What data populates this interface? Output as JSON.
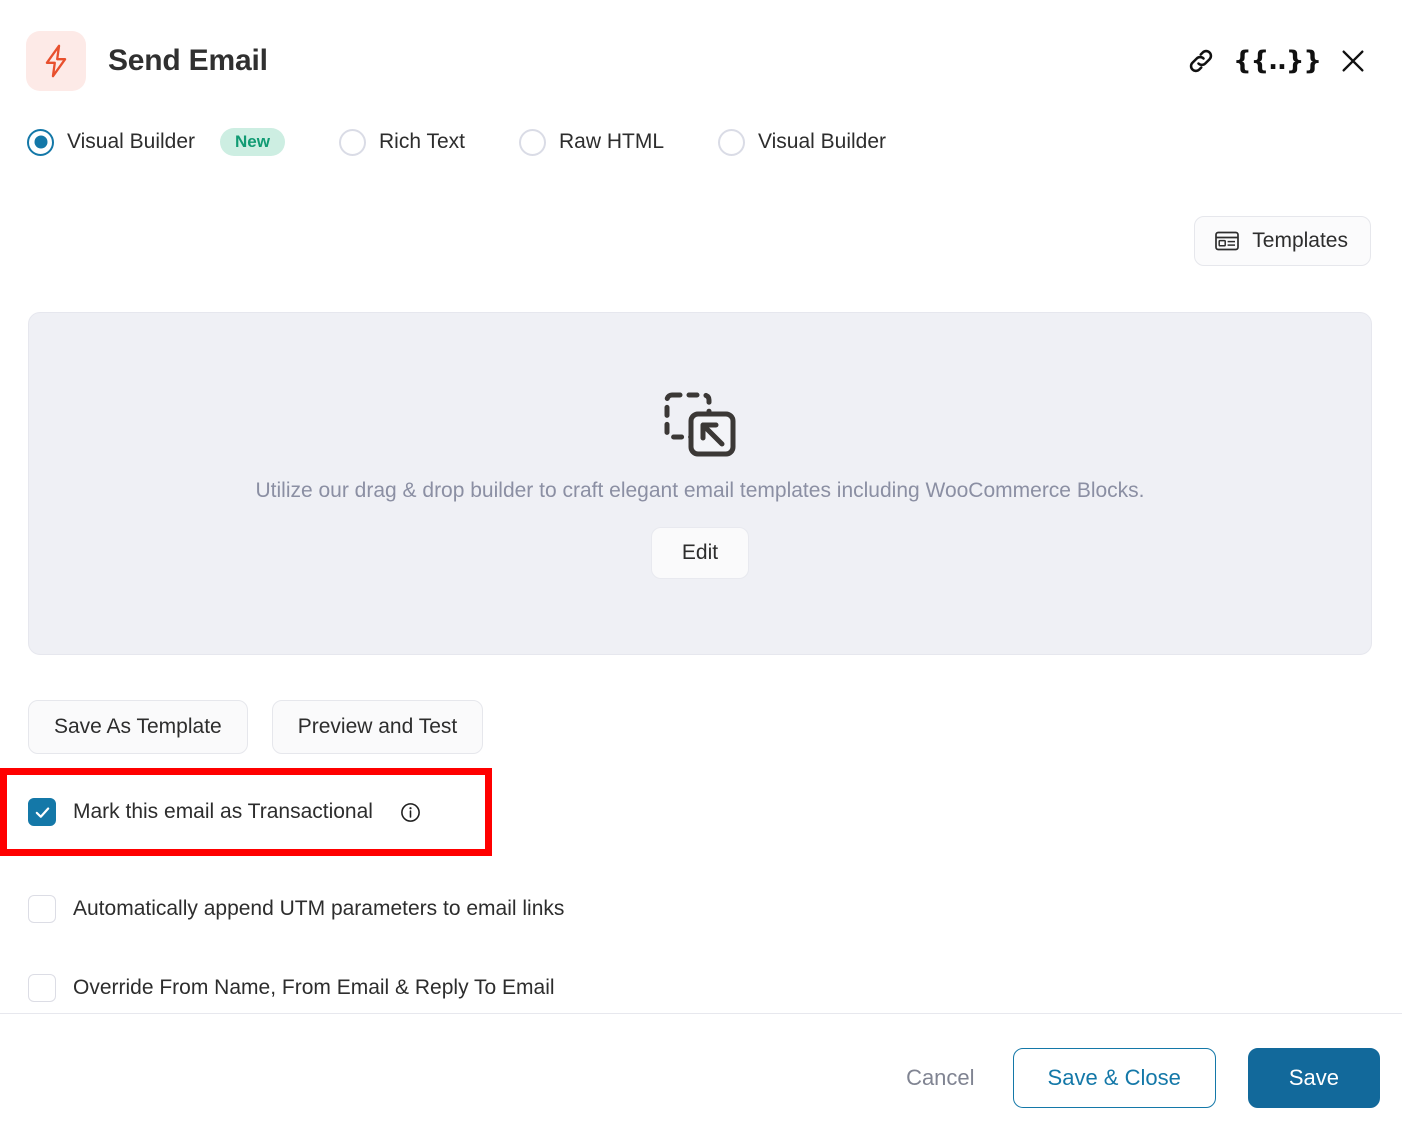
{
  "header": {
    "title": "Send Email",
    "app_icon": "lightning-bolt-icon",
    "icon_bg": "#fdeae7",
    "icon_color": "#e8502e",
    "actions": [
      {
        "name": "link-icon",
        "label": "Link"
      },
      {
        "name": "merge-tag-icon",
        "label": "{{..}}"
      },
      {
        "name": "close-icon",
        "label": "Close"
      }
    ]
  },
  "editor_modes": {
    "selected_index": 0,
    "options": [
      {
        "label": "Visual Builder",
        "badge": "New",
        "selected": true
      },
      {
        "label": "Rich Text",
        "badge": null,
        "selected": false
      },
      {
        "label": "Raw HTML",
        "badge": null,
        "selected": false
      },
      {
        "label": "Visual Builder",
        "badge": null,
        "selected": false
      }
    ]
  },
  "toolbar": {
    "templates_label": "Templates"
  },
  "builder_panel": {
    "icon": "drag-and-drop-icon",
    "description": "Utilize our drag & drop builder to craft elegant email templates including WooCommerce Blocks.",
    "edit_label": "Edit",
    "background": "#eff0f5"
  },
  "secondary_actions": {
    "save_as_template_label": "Save As Template",
    "preview_and_test_label": "Preview and Test"
  },
  "checkboxes": [
    {
      "label": "Mark this email as Transactional",
      "checked": true,
      "has_info": true,
      "highlighted": true
    },
    {
      "label": "Automatically append UTM parameters to email links",
      "checked": false,
      "has_info": false,
      "highlighted": false
    },
    {
      "label": "Override From Name, From Email & Reply To Email",
      "checked": false,
      "has_info": false,
      "highlighted": false
    }
  ],
  "footer": {
    "cancel_label": "Cancel",
    "save_close_label": "Save & Close",
    "save_label": "Save"
  },
  "colors": {
    "accent_blue": "#1478a8",
    "save_blue": "#12699b",
    "badge_bg": "#cdeee2",
    "badge_text": "#119b73",
    "highlight_red": "#ff0000",
    "panel_bg": "#eff0f5"
  }
}
